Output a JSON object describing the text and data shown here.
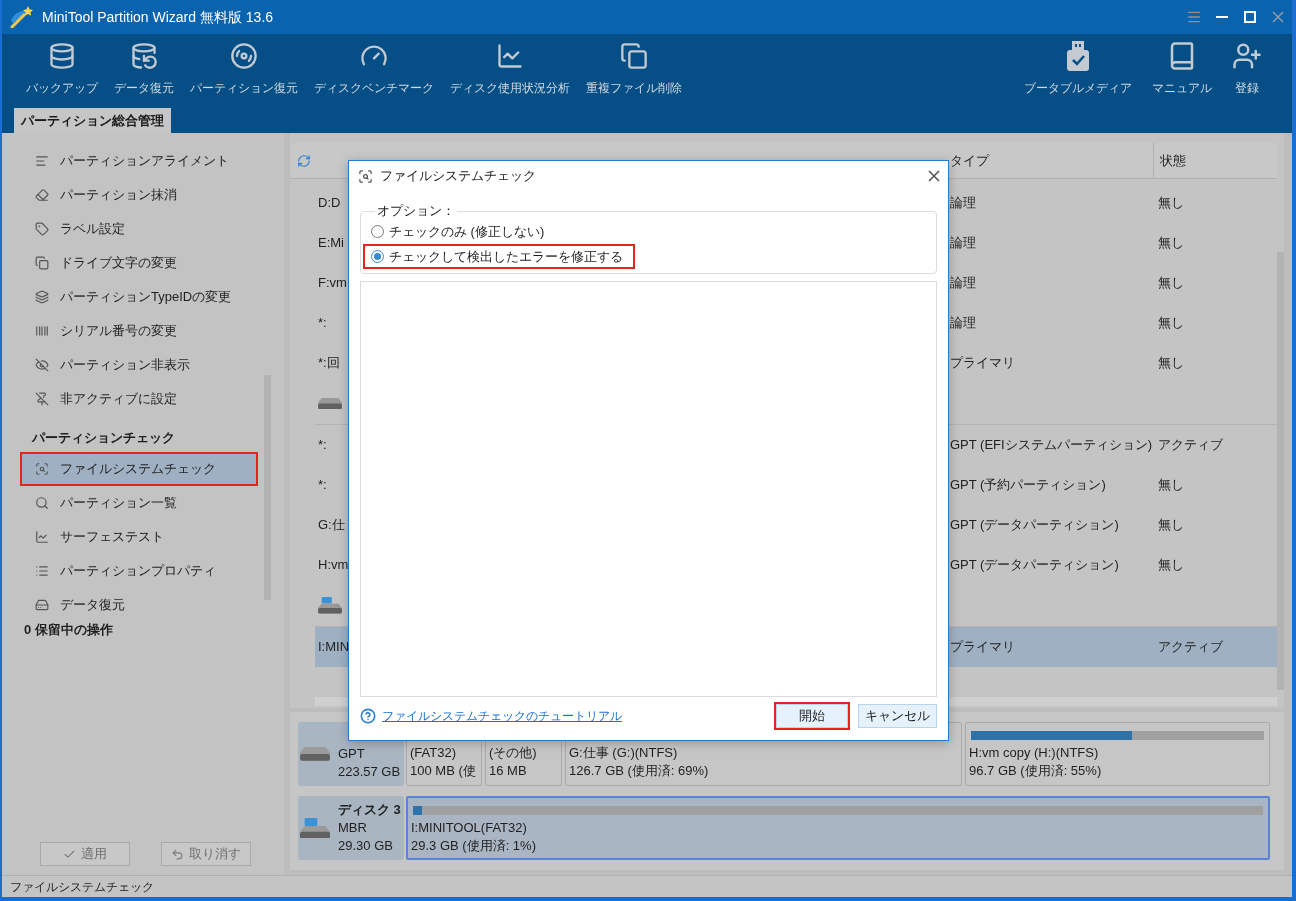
{
  "window": {
    "title": "MiniTool Partition Wizard 無料版 13.6"
  },
  "toolbar": {
    "left": [
      "バックアップ",
      "データ復元",
      "パーティション復元",
      "ディスクベンチマーク",
      "ディスク使用状況分析",
      "重複ファイル削除"
    ],
    "right": [
      "ブータブルメディア",
      "マニュアル",
      "登録"
    ]
  },
  "tabs": [
    {
      "label": "パーティション総合管理",
      "selected": true
    }
  ],
  "sidebar": {
    "groups": [
      {
        "items": [
          {
            "label": "パーティションアライメント",
            "selected": false,
            "annotated": false
          },
          {
            "label": "パーティション抹消",
            "selected": false,
            "annotated": false
          },
          {
            "label": "ラベル設定",
            "selected": false,
            "annotated": false
          },
          {
            "label": "ドライブ文字の変更",
            "selected": false,
            "annotated": false
          },
          {
            "label": "パーティションTypeIDの変更",
            "selected": false,
            "annotated": false
          },
          {
            "label": "シリアル番号の変更",
            "selected": false,
            "annotated": false
          },
          {
            "label": "パーティション非表示",
            "selected": false,
            "annotated": false
          },
          {
            "label": "非アクティブに設定",
            "selected": false,
            "annotated": false
          }
        ]
      },
      {
        "title": "パーティションチェック",
        "items": [
          {
            "label": "ファイルシステムチェック",
            "selected": true,
            "annotated": true
          },
          {
            "label": "パーティション一覧",
            "selected": false,
            "annotated": false
          },
          {
            "label": "サーフェステスト",
            "selected": false,
            "annotated": false
          },
          {
            "label": "パーティションプロパティ",
            "selected": false,
            "annotated": false
          },
          {
            "label": "データ復元",
            "selected": false,
            "annotated": false
          }
        ]
      }
    ],
    "pending_operations": "0 保留中の操作",
    "buttons": [
      {
        "label": "適用",
        "disabled": true
      },
      {
        "label": "取り消す",
        "disabled": true
      }
    ]
  },
  "table": {
    "columns": [
      "タイプ",
      "状態"
    ],
    "rows": [
      {
        "kind": "partition",
        "partition": "D:D",
        "type": "論理",
        "status": "無し",
        "selected": false
      },
      {
        "kind": "partition",
        "partition": "E:Mi",
        "type": "論理",
        "status": "無し",
        "selected": false
      },
      {
        "kind": "partition",
        "partition": "F:vm",
        "type": "論理",
        "status": "無し",
        "selected": false
      },
      {
        "kind": "partition",
        "partition": "*:",
        "type": "論理",
        "status": "無し",
        "selected": false
      },
      {
        "kind": "partition",
        "partition": "*:回",
        "type": "プライマリ",
        "status": "無し",
        "selected": false
      },
      {
        "kind": "disk",
        "selected": false
      },
      {
        "kind": "partition",
        "partition": "*:",
        "type": "GPT (EFIシステムパーティション)",
        "status": "アクティブ",
        "selected": false
      },
      {
        "kind": "partition",
        "partition": "*:",
        "type": "GPT (予約パーティション)",
        "status": "無し",
        "selected": false
      },
      {
        "kind": "partition",
        "partition": "G:仕",
        "type": "GPT (データパーティション)",
        "status": "無し",
        "selected": false
      },
      {
        "kind": "partition",
        "partition": "H:vm",
        "type": "GPT (データパーティション)",
        "status": "無し",
        "selected": false
      },
      {
        "kind": "usb_disk",
        "selected": false
      },
      {
        "kind": "partition",
        "partition": "I:MIN",
        "type": "プライマリ",
        "status": "アクティブ",
        "selected": true
      }
    ]
  },
  "disk_map": {
    "disks": [
      {
        "kind": "hdd",
        "type": "GPT",
        "size": "223.57 GB",
        "partitions": [
          {
            "label": "(FAT32)",
            "detail": "100 MB (使",
            "selected": false
          },
          {
            "label": "(その他)",
            "detail": "16 MB",
            "selected": false
          },
          {
            "label": "G:仕事 (G:)(NTFS)",
            "detail": "126.7 GB (使用済: 69%)",
            "selected": false
          },
          {
            "label": "H:vm copy (H:)(NTFS)",
            "detail": "96.7 GB (使用済: 55%)",
            "level": 0.55,
            "selected": false
          }
        ]
      },
      {
        "kind": "usb",
        "name": "ディスク 3",
        "type": "MBR",
        "size": "29.30 GB",
        "partitions": [
          {
            "label": "I:MINITOOL(FAT32)",
            "detail": "29.3 GB (使用済: 1%)",
            "level": 0.01,
            "selected": true
          }
        ]
      }
    ]
  },
  "dialog": {
    "title": "ファイルシステムチェック",
    "options_label": "オプション：",
    "options": [
      {
        "label": "チェックのみ (修正しない)",
        "selected": false,
        "annotated": false
      },
      {
        "label": "チェックして検出したエラーを修正する",
        "selected": true,
        "annotated": true
      }
    ],
    "help_link": "ファイルシステムチェックのチュートリアル",
    "buttons": [
      {
        "label": "開始",
        "annotated": true
      },
      {
        "label": "キャンセル",
        "annotated": false
      }
    ]
  },
  "status_bar": "ファイルシステムチェック"
}
